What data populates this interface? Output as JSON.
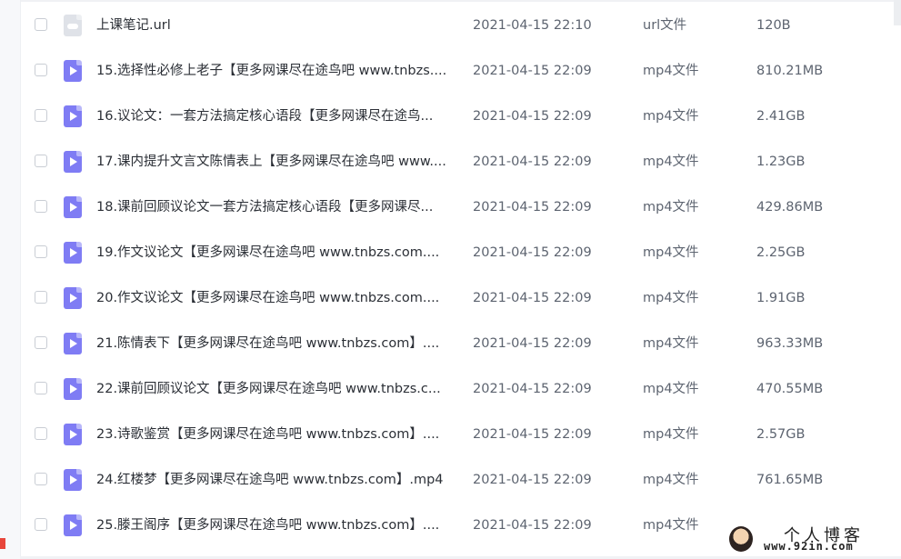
{
  "files": [
    {
      "name": "上课笔记.url",
      "date": "2021-04-15 22:10",
      "type": "url文件",
      "size": "120B",
      "icon": "link-file-icon"
    },
    {
      "name": "15.选择性必修上老子【更多网课尽在途鸟吧 www.tnbzs....",
      "date": "2021-04-15 22:09",
      "type": "mp4文件",
      "size": "810.21MB",
      "icon": "video-file-icon"
    },
    {
      "name": "16.议论文：一套方法搞定核心语段【更多网课尽在途鸟...",
      "date": "2021-04-15 22:09",
      "type": "mp4文件",
      "size": "2.41GB",
      "icon": "video-file-icon"
    },
    {
      "name": "17.课内提升文言文陈情表上【更多网课尽在途鸟吧 www....",
      "date": "2021-04-15 22:09",
      "type": "mp4文件",
      "size": "1.23GB",
      "icon": "video-file-icon"
    },
    {
      "name": "18.课前回顾议论文一套方法搞定核心语段【更多网课尽...",
      "date": "2021-04-15 22:09",
      "type": "mp4文件",
      "size": "429.86MB",
      "icon": "video-file-icon"
    },
    {
      "name": "19.作文议论文【更多网课尽在途鸟吧 www.tnbzs.com....",
      "date": "2021-04-15 22:09",
      "type": "mp4文件",
      "size": "2.25GB",
      "icon": "video-file-icon"
    },
    {
      "name": "20.作文议论文【更多网课尽在途鸟吧 www.tnbzs.com....",
      "date": "2021-04-15 22:09",
      "type": "mp4文件",
      "size": "1.91GB",
      "icon": "video-file-icon"
    },
    {
      "name": "21.陈情表下【更多网课尽在途鸟吧 www.tnbzs.com】....",
      "date": "2021-04-15 22:09",
      "type": "mp4文件",
      "size": "963.33MB",
      "icon": "video-file-icon"
    },
    {
      "name": "22.课前回顾议论文【更多网课尽在途鸟吧 www.tnbzs.c...",
      "date": "2021-04-15 22:09",
      "type": "mp4文件",
      "size": "470.55MB",
      "icon": "video-file-icon"
    },
    {
      "name": "23.诗歌鉴赏【更多网课尽在途鸟吧 www.tnbzs.com】....",
      "date": "2021-04-15 22:09",
      "type": "mp4文件",
      "size": "2.57GB",
      "icon": "video-file-icon"
    },
    {
      "name": "24.红楼梦【更多网课尽在途鸟吧 www.tnbzs.com】.mp4",
      "date": "2021-04-15 22:09",
      "type": "mp4文件",
      "size": "761.65MB",
      "icon": "video-file-icon"
    },
    {
      "name": "25.滕王阁序【更多网课尽在途鸟吧 www.tnbzs.com】....",
      "date": "2021-04-15 22:09",
      "type": "mp4文件",
      "size": "",
      "icon": "video-file-icon"
    }
  ],
  "watermark": {
    "title": "个人博客",
    "url": "www.92in.com"
  },
  "colors": {
    "video_icon": "#7f7cf4",
    "link_icon": "#dfe2e8",
    "text_primary": "#2b2f36",
    "text_secondary": "#5d6470"
  }
}
